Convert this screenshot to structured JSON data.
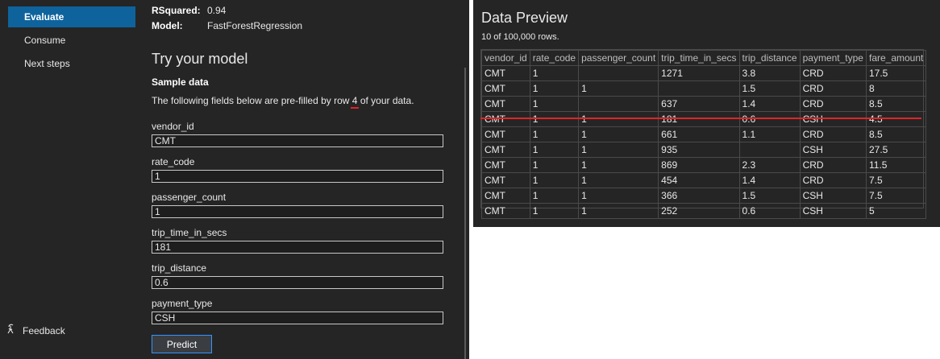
{
  "sidebar": {
    "items": [
      {
        "label": "Evaluate"
      },
      {
        "label": "Consume"
      },
      {
        "label": "Next steps"
      }
    ],
    "feedback": "Feedback"
  },
  "metrics": {
    "rsquared_label": "RSquared:",
    "rsquared_value": "0.94",
    "model_label": "Model:",
    "model_value": "FastForestRegression"
  },
  "try_model": {
    "title": "Try your model",
    "sample_heading": "Sample data",
    "prefill_before": "The following fields below are pre-filled by row ",
    "row_number": "4",
    "prefill_after": " of your data.",
    "fields": [
      {
        "label": "vendor_id",
        "value": "CMT"
      },
      {
        "label": "rate_code",
        "value": "1"
      },
      {
        "label": "passenger_count",
        "value": "1"
      },
      {
        "label": "trip_time_in_secs",
        "value": "181"
      },
      {
        "label": "trip_distance",
        "value": "0.6"
      },
      {
        "label": "payment_type",
        "value": "CSH"
      }
    ],
    "predict_label": "Predict"
  },
  "preview": {
    "title": "Data Preview",
    "count": "10 of 100,000 rows.",
    "columns": [
      "vendor_id",
      "rate_code",
      "passenger_count",
      "trip_time_in_secs",
      "trip_distance",
      "payment_type",
      "fare_amount"
    ],
    "rows": [
      [
        "CMT",
        "1",
        "",
        "1271",
        "3.8",
        "CRD",
        "17.5"
      ],
      [
        "CMT",
        "1",
        "1",
        "",
        "1.5",
        "CRD",
        "8"
      ],
      [
        "CMT",
        "1",
        "",
        "637",
        "1.4",
        "CRD",
        "8.5"
      ],
      [
        "CMT",
        "1",
        "1",
        "181",
        "0.6",
        "CSH",
        "4.5"
      ],
      [
        "CMT",
        "1",
        "1",
        "661",
        "1.1",
        "CRD",
        "8.5"
      ],
      [
        "CMT",
        "1",
        "1",
        "935",
        "",
        "CSH",
        "27.5"
      ],
      [
        "CMT",
        "1",
        "1",
        "869",
        "2.3",
        "CRD",
        "11.5"
      ],
      [
        "CMT",
        "1",
        "1",
        "454",
        "1.4",
        "CRD",
        "7.5"
      ],
      [
        "CMT",
        "1",
        "1",
        "366",
        "1.5",
        "CSH",
        "7.5"
      ],
      [
        "CMT",
        "1",
        "1",
        "252",
        "0.6",
        "CSH",
        "5"
      ]
    ]
  },
  "colors": {
    "panel_bg": "#252526",
    "accent": "#0e639c",
    "annotation_red": "#e02424"
  }
}
